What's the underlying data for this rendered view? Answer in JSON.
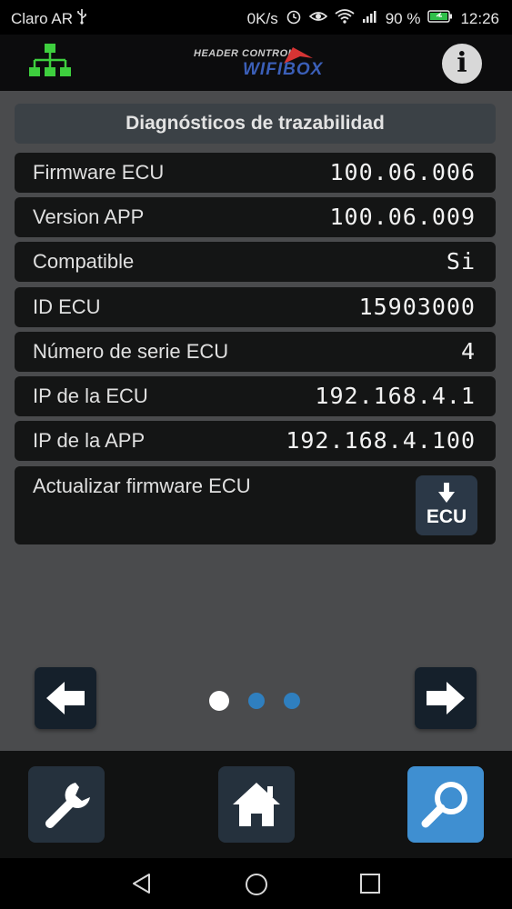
{
  "status_bar": {
    "carrier": "Claro AR",
    "net_speed": "0K/s",
    "battery_percent": "90 %",
    "time": "12:26",
    "icons": [
      "usb-icon",
      "alarm-icon",
      "eye-icon",
      "wifi-icon",
      "signal-icon",
      "battery-icon"
    ]
  },
  "header": {
    "logo_top_text": "HEADER CONTROL",
    "logo_main_text": "WIFIBOX",
    "info_label": "i",
    "icons": [
      "network-icon",
      "info-icon"
    ]
  },
  "panel": {
    "title": "Diagnósticos de trazabilidad",
    "rows": [
      {
        "label": "Firmware ECU",
        "value": "100.06.006"
      },
      {
        "label": "Version APP",
        "value": "100.06.009"
      },
      {
        "label": "Compatible",
        "value": "Si"
      },
      {
        "label": "ID ECU",
        "value": "15903000"
      },
      {
        "label": "Número de serie ECU",
        "value": "4"
      },
      {
        "label": "IP de la ECU",
        "value": "192.168.4.1"
      },
      {
        "label": "IP de la APP",
        "value": "192.168.4.100"
      }
    ],
    "update_label": "Actualizar firmware ECU",
    "update_button_text": "ECU"
  },
  "pager": {
    "pages": 3,
    "current_page": 1,
    "icons": [
      "arrow-left-icon",
      "arrow-right-icon"
    ]
  },
  "toolbar": {
    "active": "search",
    "icons": [
      "wrench-icon",
      "home-icon",
      "search-icon"
    ]
  },
  "system_nav": {
    "icons": [
      "back-icon",
      "home-circle-icon",
      "recents-icon"
    ]
  },
  "colors": {
    "background": "#4a4b4d",
    "row_bg": "#141515",
    "header_bg": "#3b4146",
    "accent": "#3f8fd1",
    "network_icon": "#3ecf3e",
    "dot_active": "#ffffff",
    "dot_inactive": "#2f7fbf"
  }
}
